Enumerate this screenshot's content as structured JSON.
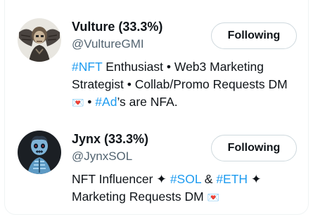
{
  "users": [
    {
      "name": "Vulture (33.3%)",
      "handle": "@VultureGMI",
      "follow_label": "Following",
      "bio": {
        "tag1": "#NFT",
        "text1": " Enthusiast • Web3 Marketing Strategist • Collab/Promo Requests DM ",
        "emoji1": "💌",
        "text2": " • ",
        "tag2": "#Ad",
        "text3": "’s are NFA."
      },
      "avatar_icon": "winged-skull-avatar-icon"
    },
    {
      "name": "Jynx (33.3%)",
      "handle": "@JynxSOL",
      "follow_label": "Following",
      "bio": {
        "text1": "NFT Influencer ✦ ",
        "tag1": "#SOL",
        "text2": " & ",
        "tag2": "#ETH",
        "text3": " ✦ Marketing Requests DM ",
        "emoji1": "💌"
      },
      "avatar_icon": "blue-skeleton-avatar-icon"
    }
  ],
  "colors": {
    "accent": "#1d9bf0",
    "text": "#0f1419",
    "secondary": "#536471",
    "border": "#cfd9de"
  }
}
